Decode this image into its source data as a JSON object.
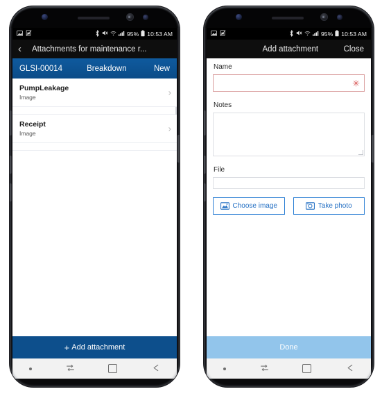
{
  "statusbar": {
    "left_icons": [
      "image-icon",
      "sim-card-off-icon"
    ],
    "bluetooth_icon": "bluetooth-icon",
    "mute_icon": "mute-icon",
    "wifi_icon": "wifi-icon",
    "signal_icon": "signal-bars-icon",
    "battery_percent": "95%",
    "battery_icon": "battery-icon",
    "time": "10:53 AM"
  },
  "colors": {
    "header_blue": "#0d4f8c",
    "disabled_blue": "#92c5eb",
    "required_red": "#d6504f",
    "link_blue": "#2470c4"
  },
  "left_phone": {
    "titlebar": {
      "back_icon": "chevron-left-icon",
      "title": "Attachments for maintenance r..."
    },
    "record_header": {
      "id": "GLSI-00014",
      "type": "Breakdown",
      "status": "New"
    },
    "attachments": [
      {
        "name": "PumpLeakage",
        "type": "Image",
        "chevron": "chevron-right-icon"
      },
      {
        "name": "Receipt",
        "type": "Image",
        "chevron": "chevron-right-icon"
      }
    ],
    "action_bar": {
      "plus_icon": "plus-icon",
      "label": "Add attachment"
    }
  },
  "right_phone": {
    "titlebar": {
      "title": "Add attachment",
      "close_label": "Close"
    },
    "form": {
      "name_label": "Name",
      "name_value": "",
      "name_placeholder": "",
      "name_required_marker": "✳",
      "notes_label": "Notes",
      "notes_value": "",
      "notes_placeholder": "",
      "file_label": "File",
      "file_value": "",
      "file_placeholder": "",
      "choose_image_label": "Choose image",
      "choose_image_icon": "image-picture-icon",
      "take_photo_label": "Take photo",
      "take_photo_icon": "camera-icon"
    },
    "action_bar": {
      "label": "Done"
    }
  },
  "navbar": {
    "dot_icon": "recent-dot-icon",
    "switch_icon": "task-switch-icon",
    "home_icon": "home-square-icon",
    "back_icon": "back-arrow-icon"
  }
}
